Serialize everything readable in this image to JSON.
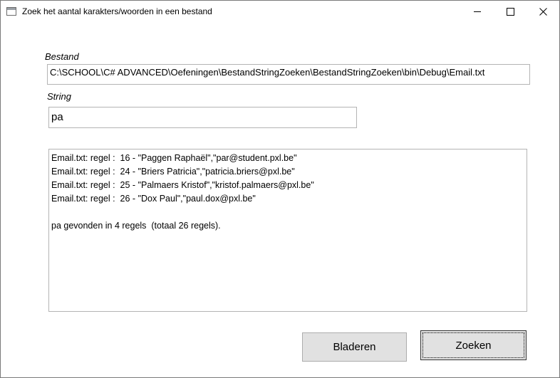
{
  "window": {
    "title": "Zoek het aantal karakters/woorden in een bestand",
    "icon": "app-window-icon",
    "caption_buttons": [
      "minimize-icon",
      "maximize-icon",
      "close-icon"
    ]
  },
  "form": {
    "bestand_label": "Bestand",
    "bestand_value": "C:\\SCHOOL\\C# ADVANCED\\Oefeningen\\BestandStringZoeken\\BestandStringZoeken\\bin\\Debug\\Email.txt",
    "string_label": "String",
    "string_value": "pa"
  },
  "results": {
    "lines": [
      "Email.txt: regel :  16 - \"Paggen Raphaël\",\"par@student.pxl.be\"",
      "Email.txt: regel :  24 - \"Briers Patricia\",\"patricia.briers@pxl.be\"",
      "Email.txt: regel :  25 - \"Palmaers Kristof\",\"kristof.palmaers@pxl.be\"",
      "Email.txt: regel :  26 - \"Dox Paul\",\"paul.dox@pxl.be\""
    ],
    "summary": "pa gevonden in 4 regels  (totaal 26 regels)."
  },
  "buttons": {
    "bladeren": "Bladeren",
    "zoeken": "Zoeken"
  },
  "colors": {
    "button_face": "#e1e1e1",
    "border": "#b4b4b4",
    "text": "#000000"
  }
}
